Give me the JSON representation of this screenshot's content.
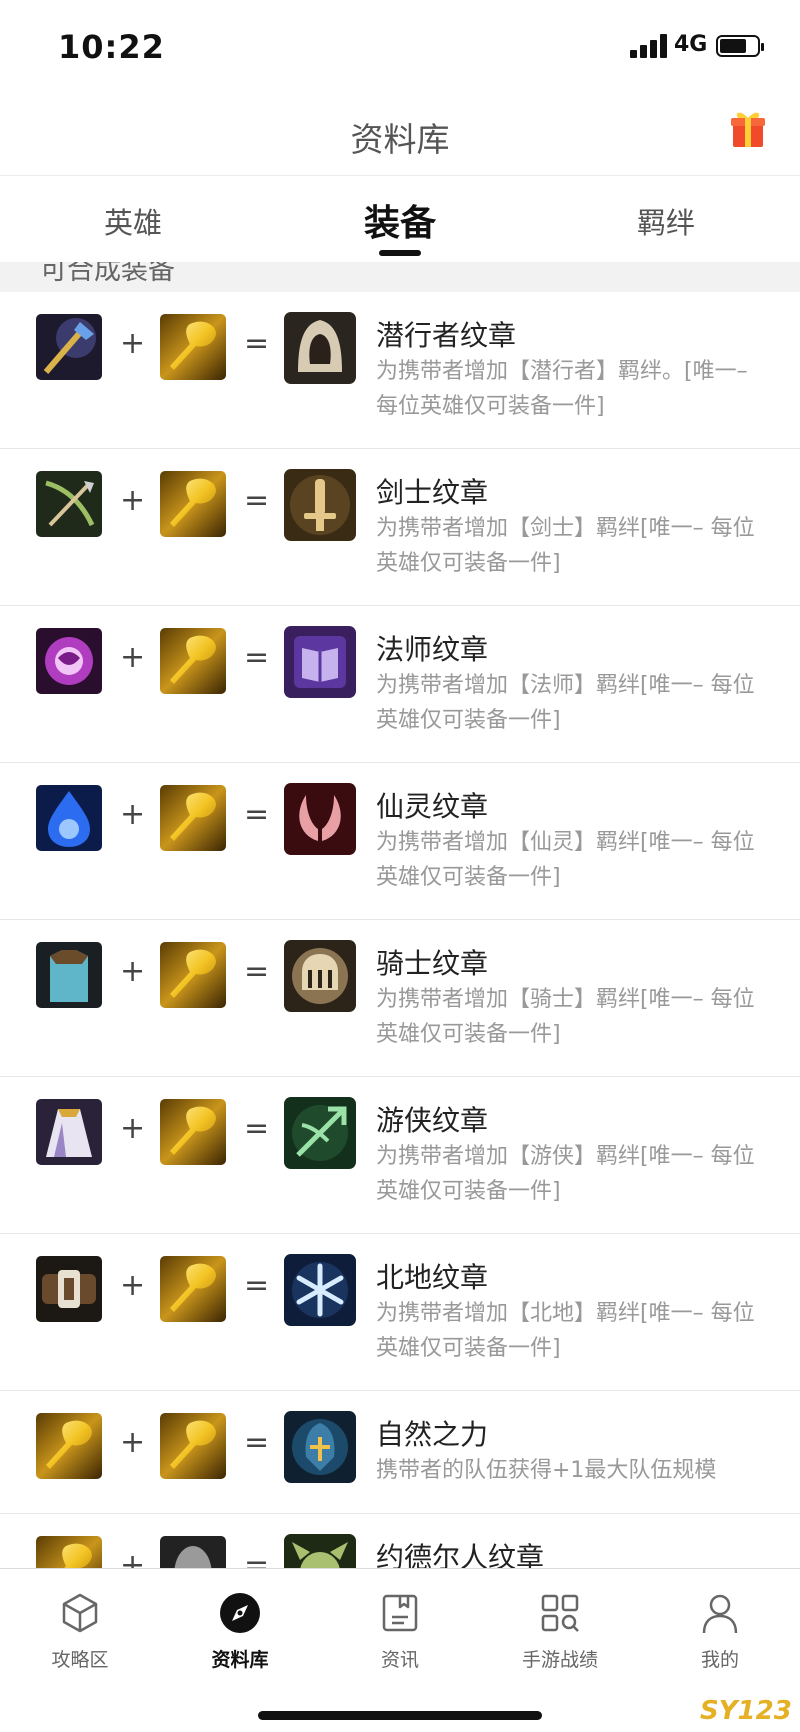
{
  "status_bar": {
    "time": "10:22",
    "network": "4G"
  },
  "header": {
    "title": "资料库"
  },
  "tabs": [
    {
      "label": "英雄"
    },
    {
      "label": "装备"
    },
    {
      "label": "羁绊"
    }
  ],
  "section": {
    "title": "可合成装备"
  },
  "items": [
    {
      "name": "潜行者纹章",
      "desc": "为携带者增加【潜行者】羁绊。[唯一– 每位英雄仅可装备一件]",
      "icons": [
        "staff-icon",
        "spatula-icon",
        "hooded-assassin-icon"
      ]
    },
    {
      "name": "剑士纹章",
      "desc": "为携带者增加【剑士】羁绊[唯一– 每位英雄仅可装备一件]",
      "icons": [
        "bow-icon",
        "spatula-icon",
        "sword-icon"
      ]
    },
    {
      "name": "法师纹章",
      "desc": "为携带者增加【法师】羁绊[唯一– 每位英雄仅可装备一件]",
      "icons": [
        "dragon-orb-icon",
        "spatula-icon",
        "spellbook-icon"
      ]
    },
    {
      "name": "仙灵纹章",
      "desc": "为携带者增加【仙灵】羁绊[唯一– 每位英雄仅可装备一件]",
      "icons": [
        "tear-gem-icon",
        "spatula-icon",
        "wings-icon"
      ]
    },
    {
      "name": "骑士纹章",
      "desc": "为携带者增加【骑士】羁绊[唯一– 每位英雄仅可装备一件]",
      "icons": [
        "chain-vest-icon",
        "spatula-icon",
        "knight-helmet-icon"
      ]
    },
    {
      "name": "游侠纹章",
      "desc": "为携带者增加【游侠】羁绊[唯一– 每位英雄仅可装备一件]",
      "icons": [
        "cloak-icon",
        "spatula-icon",
        "crossbow-icon"
      ]
    },
    {
      "name": "北地纹章",
      "desc": "为携带者增加【北地】羁绊[唯一– 每位英雄仅可装备一件]",
      "icons": [
        "belt-icon",
        "spatula-icon",
        "snowflake-icon"
      ]
    },
    {
      "name": "自然之力",
      "desc": "携带者的队伍获得+1最大队伍规模",
      "icons": [
        "spatula-icon",
        "spatula-icon",
        "force-of-nature-icon"
      ]
    },
    {
      "name": "约德尔人纹章",
      "desc": "",
      "icons": [
        "spatula-icon",
        "helmet-icon",
        "yordle-icon"
      ]
    }
  ],
  "nav": [
    {
      "label": "攻略区"
    },
    {
      "label": "资料库"
    },
    {
      "label": "资讯"
    },
    {
      "label": "手游战绩"
    },
    {
      "label": "我的"
    }
  ],
  "watermark": "SY123"
}
